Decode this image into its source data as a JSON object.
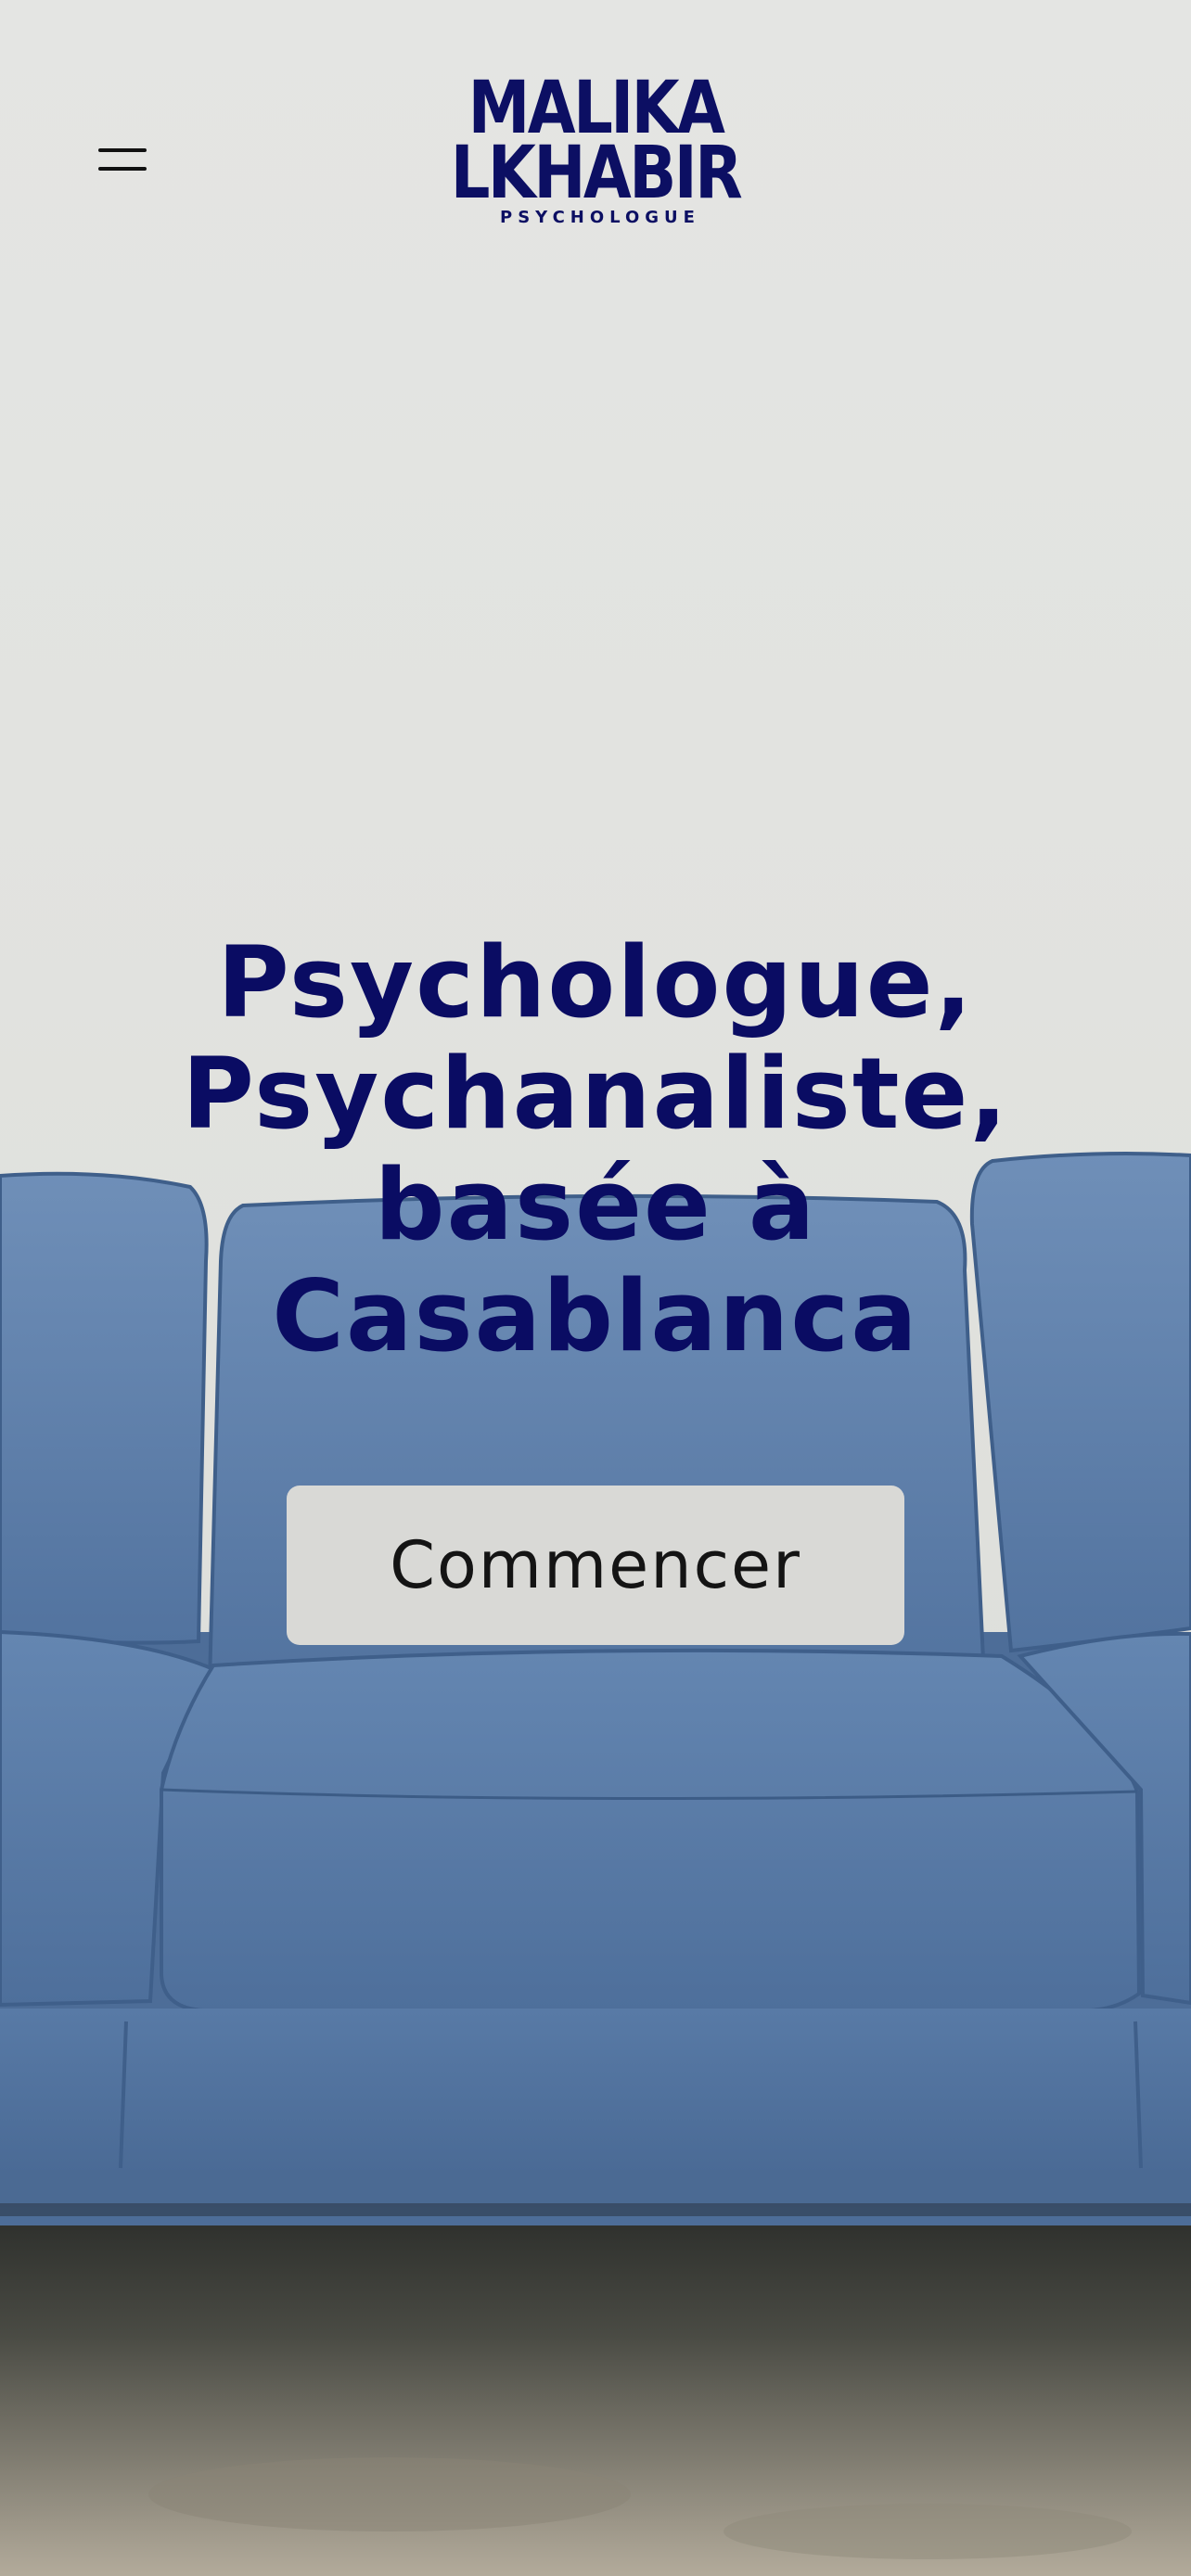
{
  "header": {
    "menu_icon": "hamburger-menu-icon",
    "logo": {
      "line1": "MALIKA",
      "line2": "LKHABIR",
      "subtitle": "PSYCHOLOGUE"
    }
  },
  "hero": {
    "headline_lines": [
      "Psychologue,",
      "Psychanaliste,",
      "basée à",
      "Casablanca"
    ],
    "cta_label": "Commencer",
    "background_image": "blue-leather-sofa-photo"
  },
  "colors": {
    "brand_navy": "#0a0c63",
    "button_bg": "#d9d9d6",
    "wall": "#e2e3e0",
    "sofa": "#5a7eab"
  }
}
